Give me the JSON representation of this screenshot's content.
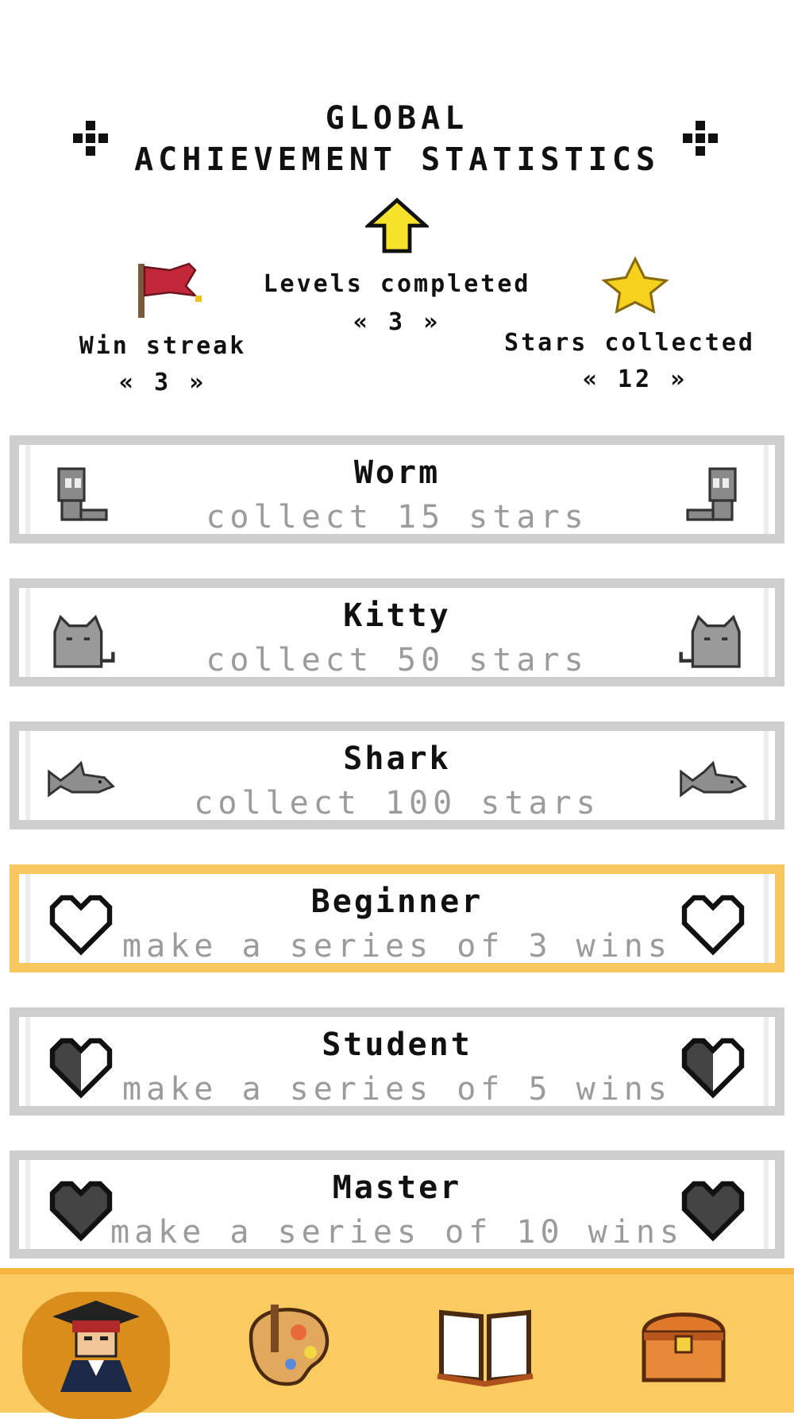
{
  "header": {
    "title_line1": "GLOBAL",
    "title_line2": "ACHIEVEMENT STATISTICS"
  },
  "stats": {
    "levels": {
      "label": "Levels completed",
      "value": "« 3 »",
      "icon": "arrow-up-icon"
    },
    "win_streak": {
      "label": "Win streak",
      "value": "« 3 »",
      "icon": "red-flag-icon"
    },
    "stars": {
      "label": "Stars collected",
      "value": "« 12 »",
      "icon": "star-icon"
    }
  },
  "achievements": [
    {
      "title": "Worm",
      "subtitle": "collect 15 stars",
      "icon": "worm-icon",
      "highlighted": false
    },
    {
      "title": "Kitty",
      "subtitle": "collect 50 stars",
      "icon": "cat-icon",
      "highlighted": false
    },
    {
      "title": "Shark",
      "subtitle": "collect 100 stars",
      "icon": "shark-icon",
      "highlighted": false
    },
    {
      "title": "Beginner",
      "subtitle": "make a series of 3 wins",
      "icon": "heart-empty-icon",
      "highlighted": true
    },
    {
      "title": "Student",
      "subtitle": "make a series of 5 wins",
      "icon": "heart-half-icon",
      "highlighted": false
    },
    {
      "title": "Master",
      "subtitle": "make a series of 10 wins",
      "icon": "heart-full-icon",
      "highlighted": false
    }
  ],
  "nav": [
    {
      "icon": "graduate-avatar-icon",
      "active": true
    },
    {
      "icon": "palette-icon",
      "active": false
    },
    {
      "icon": "book-icon",
      "active": false
    },
    {
      "icon": "treasure-chest-icon",
      "active": false
    }
  ],
  "colors": {
    "highlight_border": "#f9c760",
    "card_border": "#cfcfcf",
    "navbar": "#fbcb62",
    "nav_active": "#d98d1b",
    "subtitle_text": "#9b9b9b"
  }
}
